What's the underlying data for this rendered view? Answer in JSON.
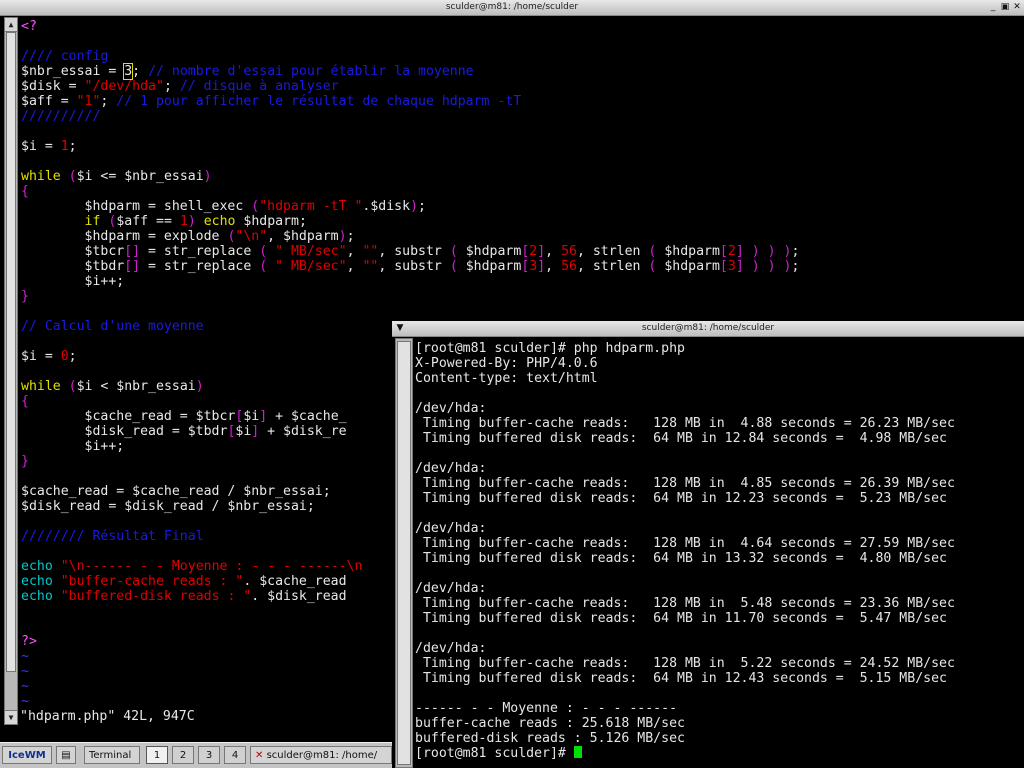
{
  "editor_window": {
    "title": "sculder@m81: /home/sculder",
    "status_line": "\"hdparm.php\" 42L, 947C",
    "lines": [
      [
        [
          "<?",
          "tag"
        ]
      ],
      [],
      [
        [
          "//// config",
          "com"
        ]
      ],
      [
        [
          "$nbr_essai = ",
          "dflt"
        ],
        [
          "3",
          "cursor"
        ],
        [
          "; ",
          "dflt"
        ],
        [
          "// nombre d'essai pour établir la moyenne",
          "com"
        ]
      ],
      [
        [
          "$disk = ",
          "dflt"
        ],
        [
          "\"/dev/hda\"",
          "str"
        ],
        [
          "; ",
          "dflt"
        ],
        [
          "// disque à analyser",
          "com"
        ]
      ],
      [
        [
          "$aff = ",
          "dflt"
        ],
        [
          "\"1\"",
          "str"
        ],
        [
          "; ",
          "dflt"
        ],
        [
          "// 1 pour afficher le résultat de chaque hdparm -tT",
          "com"
        ]
      ],
      [
        [
          "//////////",
          "com"
        ]
      ],
      [],
      [
        [
          "$i = ",
          "dflt"
        ],
        [
          "1",
          "num"
        ],
        [
          ";",
          "dflt"
        ]
      ],
      [],
      [
        [
          "while",
          "kw"
        ],
        [
          " ",
          "dflt"
        ],
        [
          "(",
          "par"
        ],
        [
          "$i <= $nbr_essai",
          "dflt"
        ],
        [
          ")",
          "par"
        ]
      ],
      [
        [
          "{",
          "par"
        ]
      ],
      [
        [
          "        $hdparm = shell_exec ",
          "dflt"
        ],
        [
          "(",
          "par"
        ],
        [
          "\"hdparm -tT \"",
          "str"
        ],
        [
          ".$disk",
          "dflt"
        ],
        [
          ")",
          "par"
        ],
        [
          ";",
          "dflt"
        ]
      ],
      [
        [
          "        ",
          "dflt"
        ],
        [
          "if",
          "kw"
        ],
        [
          " ",
          "dflt"
        ],
        [
          "(",
          "par"
        ],
        [
          "$aff == ",
          "dflt"
        ],
        [
          "1",
          "num"
        ],
        [
          ")",
          "par"
        ],
        [
          " ",
          "dflt"
        ],
        [
          "echo",
          "kw"
        ],
        [
          " $hdparm;",
          "dflt"
        ]
      ],
      [
        [
          "        $hdparm = explode ",
          "dflt"
        ],
        [
          "(",
          "par"
        ],
        [
          "\"\\n\"",
          "str"
        ],
        [
          ", $hdparm",
          "dflt"
        ],
        [
          ")",
          "par"
        ],
        [
          ";",
          "dflt"
        ]
      ],
      [
        [
          "        $tbcr",
          "dflt"
        ],
        [
          "[]",
          "par"
        ],
        [
          " = str_replace ",
          "dflt"
        ],
        [
          "(",
          "par"
        ],
        [
          " ",
          "dflt"
        ],
        [
          "\" MB/sec\"",
          "str"
        ],
        [
          ", ",
          "dflt"
        ],
        [
          "\"\"",
          "str"
        ],
        [
          ", substr ",
          "dflt"
        ],
        [
          "(",
          "par"
        ],
        [
          " $hdparm",
          "dflt"
        ],
        [
          "[",
          "par"
        ],
        [
          "2",
          "num"
        ],
        [
          "]",
          "par"
        ],
        [
          ", ",
          "dflt"
        ],
        [
          "56",
          "num"
        ],
        [
          ", strlen ",
          "dflt"
        ],
        [
          "(",
          "par"
        ],
        [
          " $hdparm",
          "dflt"
        ],
        [
          "[",
          "par"
        ],
        [
          "2",
          "num"
        ],
        [
          "]",
          "par"
        ],
        [
          " ",
          "dflt"
        ],
        [
          ")",
          "par"
        ],
        [
          " ",
          "dflt"
        ],
        [
          ")",
          "par"
        ],
        [
          " ",
          "dflt"
        ],
        [
          ")",
          "par"
        ],
        [
          ";",
          "dflt"
        ]
      ],
      [
        [
          "        $tbdr",
          "dflt"
        ],
        [
          "[]",
          "par"
        ],
        [
          " = str_replace ",
          "dflt"
        ],
        [
          "(",
          "par"
        ],
        [
          " ",
          "dflt"
        ],
        [
          "\" MB/sec\"",
          "str"
        ],
        [
          ", ",
          "dflt"
        ],
        [
          "\"\"",
          "str"
        ],
        [
          ", substr ",
          "dflt"
        ],
        [
          "(",
          "par"
        ],
        [
          " $hdparm",
          "dflt"
        ],
        [
          "[",
          "par"
        ],
        [
          "3",
          "num"
        ],
        [
          "]",
          "par"
        ],
        [
          ", ",
          "dflt"
        ],
        [
          "56",
          "num"
        ],
        [
          ", strlen ",
          "dflt"
        ],
        [
          "(",
          "par"
        ],
        [
          " $hdparm",
          "dflt"
        ],
        [
          "[",
          "par"
        ],
        [
          "3",
          "num"
        ],
        [
          "]",
          "par"
        ],
        [
          " ",
          "dflt"
        ],
        [
          ")",
          "par"
        ],
        [
          " ",
          "dflt"
        ],
        [
          ")",
          "par"
        ],
        [
          " ",
          "dflt"
        ],
        [
          ")",
          "par"
        ],
        [
          ";",
          "dflt"
        ]
      ],
      [
        [
          "        $i++;",
          "dflt"
        ]
      ],
      [
        [
          "}",
          "par"
        ]
      ],
      [],
      [
        [
          "// Calcul d'une moyenne",
          "com"
        ]
      ],
      [],
      [
        [
          "$i = ",
          "dflt"
        ],
        [
          "0",
          "num"
        ],
        [
          ";",
          "dflt"
        ]
      ],
      [],
      [
        [
          "while",
          "kw"
        ],
        [
          " ",
          "dflt"
        ],
        [
          "(",
          "par"
        ],
        [
          "$i < $nbr_essai",
          "dflt"
        ],
        [
          ")",
          "par"
        ]
      ],
      [
        [
          "{",
          "par"
        ]
      ],
      [
        [
          "        $cache_read = $tbcr",
          "dflt"
        ],
        [
          "[",
          "par"
        ],
        [
          "$i",
          "dflt"
        ],
        [
          "]",
          "par"
        ],
        [
          " + $cache_",
          "dflt"
        ]
      ],
      [
        [
          "        $disk_read = $tbdr",
          "dflt"
        ],
        [
          "[",
          "par"
        ],
        [
          "$i",
          "dflt"
        ],
        [
          "]",
          "par"
        ],
        [
          " + $disk_re",
          "dflt"
        ]
      ],
      [
        [
          "        $i++;",
          "dflt"
        ]
      ],
      [
        [
          "}",
          "par"
        ]
      ],
      [],
      [
        [
          "$cache_read = $cache_read / $nbr_essai;",
          "dflt"
        ]
      ],
      [
        [
          "$disk_read = $disk_read / $nbr_essai;",
          "dflt"
        ]
      ],
      [],
      [
        [
          "//////// Résultat Final",
          "com"
        ]
      ],
      [],
      [
        [
          "echo",
          "var"
        ],
        [
          " ",
          "dflt"
        ],
        [
          "\"\\n------ - - Moyenne : - - - ------\\n",
          "str"
        ]
      ],
      [
        [
          "echo",
          "var"
        ],
        [
          " ",
          "dflt"
        ],
        [
          "\"buffer-cache reads : \"",
          "str"
        ],
        [
          ". $cache_read",
          "dflt"
        ]
      ],
      [
        [
          "echo",
          "var"
        ],
        [
          " ",
          "dflt"
        ],
        [
          "\"buffered-disk reads : \"",
          "str"
        ],
        [
          ". $disk_read",
          "dflt"
        ]
      ],
      [],
      [],
      [
        [
          "?>",
          "tag"
        ]
      ],
      [
        [
          "~",
          "tilde"
        ]
      ],
      [
        [
          "~",
          "tilde"
        ]
      ],
      [
        [
          "~",
          "tilde"
        ]
      ],
      [
        [
          "~",
          "tilde"
        ]
      ]
    ]
  },
  "terminal_window": {
    "title": "sculder@m81: /home/sculder",
    "lines": [
      "[root@m81 sculder]# php hdparm.php",
      "X-Powered-By: PHP/4.0.6",
      "Content-type: text/html",
      "",
      "/dev/hda:",
      " Timing buffer-cache reads:   128 MB in  4.88 seconds = 26.23 MB/sec",
      " Timing buffered disk reads:  64 MB in 12.84 seconds =  4.98 MB/sec",
      "",
      "/dev/hda:",
      " Timing buffer-cache reads:   128 MB in  4.85 seconds = 26.39 MB/sec",
      " Timing buffered disk reads:  64 MB in 12.23 seconds =  5.23 MB/sec",
      "",
      "/dev/hda:",
      " Timing buffer-cache reads:   128 MB in  4.64 seconds = 27.59 MB/sec",
      " Timing buffered disk reads:  64 MB in 13.32 seconds =  4.80 MB/sec",
      "",
      "/dev/hda:",
      " Timing buffer-cache reads:   128 MB in  5.48 seconds = 23.36 MB/sec",
      " Timing buffered disk reads:  64 MB in 11.70 seconds =  5.47 MB/sec",
      "",
      "/dev/hda:",
      " Timing buffer-cache reads:   128 MB in  5.22 seconds = 24.52 MB/sec",
      " Timing buffered disk reads:  64 MB in 12.43 seconds =  5.15 MB/sec",
      "",
      "------ - - Moyenne : - - - ------",
      "buffer-cache reads : 25.618 MB/sec",
      "buffered-disk reads : 5.126 MB/sec"
    ],
    "prompt": "[root@m81 sculder]# "
  },
  "taskbar": {
    "start_label": "IceWM",
    "terminal_label": "Terminal",
    "workspaces": [
      "1",
      "2",
      "3",
      "4"
    ],
    "active_workspace": 0,
    "task_label": "sculder@m81: /home/"
  },
  "colors": {
    "keyword": "#e0e000",
    "string": "#e00000",
    "comment": "#1a1ae0",
    "paren": "#d020d0",
    "echo": "#00c8c8",
    "prompt_cursor": "#00e000"
  }
}
